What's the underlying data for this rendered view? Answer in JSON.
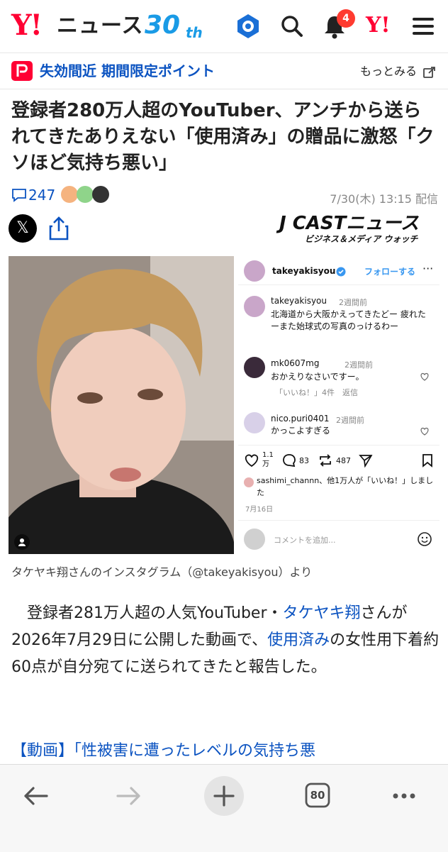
{
  "header": {
    "logo_y": "Y!",
    "logo_news": "ニュース",
    "logo_30": "30",
    "logo_th": "th",
    "notification_count": "4",
    "yahoo_icon": "Y!"
  },
  "promo": {
    "text": "失効間近 期間限定ポイント",
    "more": "もっとみる"
  },
  "article": {
    "title": "登録者280万人超のYouTuber、アンチから送られてきたありえない「使用済み」の贈品に激怒「クソほど気持ち悪い」",
    "comment_count": "247",
    "date": "7/30(木) 13:15 配信",
    "source_logo": "J CASTニュース",
    "source_sub": "ビジネス＆メディア ウォッチ",
    "caption": "タケヤキ翔さんのインスタグラム（@takeyakisyou）より",
    "body_1": "登録者281万人超の人気YouTuber・",
    "body_link_1": "タケヤキ翔",
    "body_2": "さんが2026年7月29日に公開した動画で、",
    "body_link_2": "使用済み",
    "body_3": "の女性用下着約60点が自分宛てに送られてきたと報告した。",
    "related_link": "【動画】「性被害に遭ったレベルの気持ち悪"
  },
  "instagram": {
    "username": "takeyakisyou",
    "follow": "フォローする",
    "post_user": "takeyakisyou",
    "post_time": "2週間前",
    "post_text": "北海道から大阪かえってきたどー 疲れたーまた始球式の写真のっけるわー",
    "c1_user": "mk0607mg",
    "c1_time": "2週間前",
    "c1_text": "おかえりなさいですー。",
    "c1_meta": "「いいね！」4件　返信",
    "c2_user": "nico.puri0401",
    "c2_time": "2週間前",
    "c2_text": "かっこよすぎる",
    "likes": "1.1\n万",
    "comments": "83",
    "shares": "487",
    "liked_by": "sashimi_channn、他1万人が「いいね！」しました",
    "post_date": "7月16日",
    "comment_placeholder": "コメントを追加..."
  },
  "bottom_nav": {
    "tab_count": "80"
  },
  "colors": {
    "brand_red": "#ff0033",
    "link_blue": "#0b53c1",
    "accent_blue": "#1a9be6"
  }
}
